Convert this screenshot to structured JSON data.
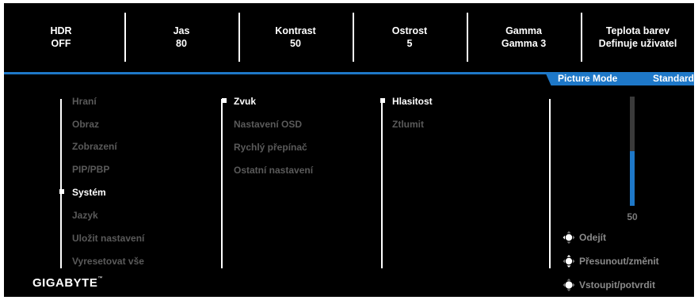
{
  "status_bar": [
    {
      "label": "HDR",
      "value": "OFF"
    },
    {
      "label": "Jas",
      "value": "80"
    },
    {
      "label": "Kontrast",
      "value": "50"
    },
    {
      "label": "Ostrost",
      "value": "5"
    },
    {
      "label": "Gamma",
      "value": "Gamma 3"
    },
    {
      "label": "Teplota barev",
      "value": "Definuje uživatel"
    }
  ],
  "picture_mode": {
    "label": "Picture Mode",
    "value": "Standard"
  },
  "colors": {
    "accent": "#1e78c8",
    "background": "#000000",
    "text_active": "#ffffff",
    "text_inactive": "#5a5a5a"
  },
  "menu_main": [
    "Hraní",
    "Obraz",
    "Zobrazení",
    "PIP/PBP",
    "Systém",
    "Jazyk",
    "Uložit nastavení",
    "Vyresetovat vše"
  ],
  "menu_main_selected": "Systém",
  "menu_sub": [
    "Zvuk",
    "Nastavení OSD",
    "Rychlý přepínač",
    "Ostatní nastavení"
  ],
  "menu_sub_selected": "Zvuk",
  "menu_third": [
    "Hlasitost",
    "Ztlumit"
  ],
  "menu_third_selected": "Hlasitost",
  "volume": {
    "value": "50",
    "level_fraction": 0.5
  },
  "hints": [
    {
      "icon": "joystick-left-icon",
      "label": "Odejít"
    },
    {
      "icon": "joystick-all-directions-icon",
      "label": "Přesunout/změnit"
    },
    {
      "icon": "joystick-press-icon",
      "label": "Vstoupit/potvrdit"
    }
  ],
  "brand": {
    "name": "GIGABYTE",
    "trademark": "™"
  }
}
